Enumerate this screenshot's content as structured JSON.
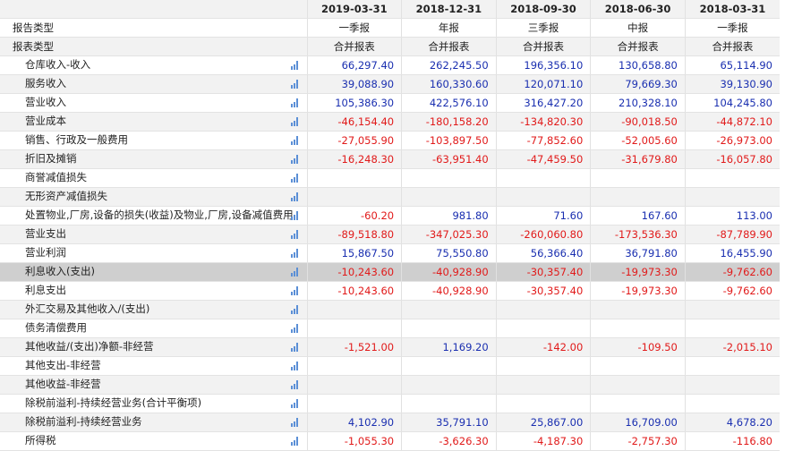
{
  "header": {
    "dates": [
      "2019-03-31",
      "2018-12-31",
      "2018-09-30",
      "2018-06-30",
      "2018-03-31"
    ]
  },
  "report_type": {
    "label": "报告类型",
    "values": [
      "一季报",
      "年报",
      "三季报",
      "中报",
      "一季报"
    ]
  },
  "statement_type": {
    "label": "报表类型",
    "values": [
      "合并报表",
      "合并报表",
      "合并报表",
      "合并报表",
      "合并报表"
    ]
  },
  "rows": [
    {
      "label": "仓库收入-收入",
      "values": [
        "66,297.40",
        "262,245.50",
        "196,356.10",
        "130,658.80",
        "65,114.90"
      ]
    },
    {
      "label": "服务收入",
      "values": [
        "39,088.90",
        "160,330.60",
        "120,071.10",
        "79,669.30",
        "39,130.90"
      ]
    },
    {
      "label": "营业收入",
      "values": [
        "105,386.30",
        "422,576.10",
        "316,427.20",
        "210,328.10",
        "104,245.80"
      ]
    },
    {
      "label": "营业成本",
      "values": [
        "-46,154.40",
        "-180,158.20",
        "-134,820.30",
        "-90,018.50",
        "-44,872.10"
      ]
    },
    {
      "label": "销售、行政及一般费用",
      "values": [
        "-27,055.90",
        "-103,897.50",
        "-77,852.60",
        "-52,005.60",
        "-26,973.00"
      ]
    },
    {
      "label": "折旧及摊销",
      "values": [
        "-16,248.30",
        "-63,951.40",
        "-47,459.50",
        "-31,679.80",
        "-16,057.80"
      ]
    },
    {
      "label": "商誉减值损失",
      "values": [
        "",
        "",
        "",
        "",
        ""
      ]
    },
    {
      "label": "无形资产减值损失",
      "values": [
        "",
        "",
        "",
        "",
        ""
      ]
    },
    {
      "label": "处置物业,厂房,设备的损失(收益)及物业,厂房,设备减值费用",
      "values": [
        "-60.20",
        "981.80",
        "71.60",
        "167.60",
        "113.00"
      ]
    },
    {
      "label": "营业支出",
      "values": [
        "-89,518.80",
        "-347,025.30",
        "-260,060.80",
        "-173,536.30",
        "-87,789.90"
      ]
    },
    {
      "label": "营业利润",
      "values": [
        "15,867.50",
        "75,550.80",
        "56,366.40",
        "36,791.80",
        "16,455.90"
      ]
    },
    {
      "label": "利息收入(支出)",
      "values": [
        "-10,243.60",
        "-40,928.90",
        "-30,357.40",
        "-19,973.30",
        "-9,762.60"
      ],
      "selected": true
    },
    {
      "label": "利息支出",
      "values": [
        "-10,243.60",
        "-40,928.90",
        "-30,357.40",
        "-19,973.30",
        "-9,762.60"
      ]
    },
    {
      "label": "外汇交易及其他收入/(支出)",
      "values": [
        "",
        "",
        "",
        "",
        ""
      ]
    },
    {
      "label": "债务清偿费用",
      "values": [
        "",
        "",
        "",
        "",
        ""
      ]
    },
    {
      "label": "其他收益/(支出)净额-非经营",
      "values": [
        "-1,521.00",
        "1,169.20",
        "-142.00",
        "-109.50",
        "-2,015.10"
      ]
    },
    {
      "label": "其他支出-非经营",
      "values": [
        "",
        "",
        "",
        "",
        ""
      ]
    },
    {
      "label": "其他收益-非经营",
      "values": [
        "",
        "",
        "",
        "",
        ""
      ]
    },
    {
      "label": "除税前溢利-持续经营业务(合计平衡项)",
      "values": [
        "",
        "",
        "",
        "",
        ""
      ]
    },
    {
      "label": "除税前溢利-持续经营业务",
      "values": [
        "4,102.90",
        "35,791.10",
        "25,867.00",
        "16,709.00",
        "4,678.20"
      ]
    },
    {
      "label": "所得税",
      "values": [
        "-1,055.30",
        "-3,626.30",
        "-4,187.30",
        "-2,757.30",
        "-116.80"
      ]
    }
  ],
  "icons": {
    "row_chart": "bar-chart-icon"
  },
  "colors": {
    "positive": "#1a2fb0",
    "negative": "#e11a1a",
    "alt_row": "#f2f2f2",
    "selected_row": "#cfcfcf",
    "icon": "#5b8fd6"
  }
}
